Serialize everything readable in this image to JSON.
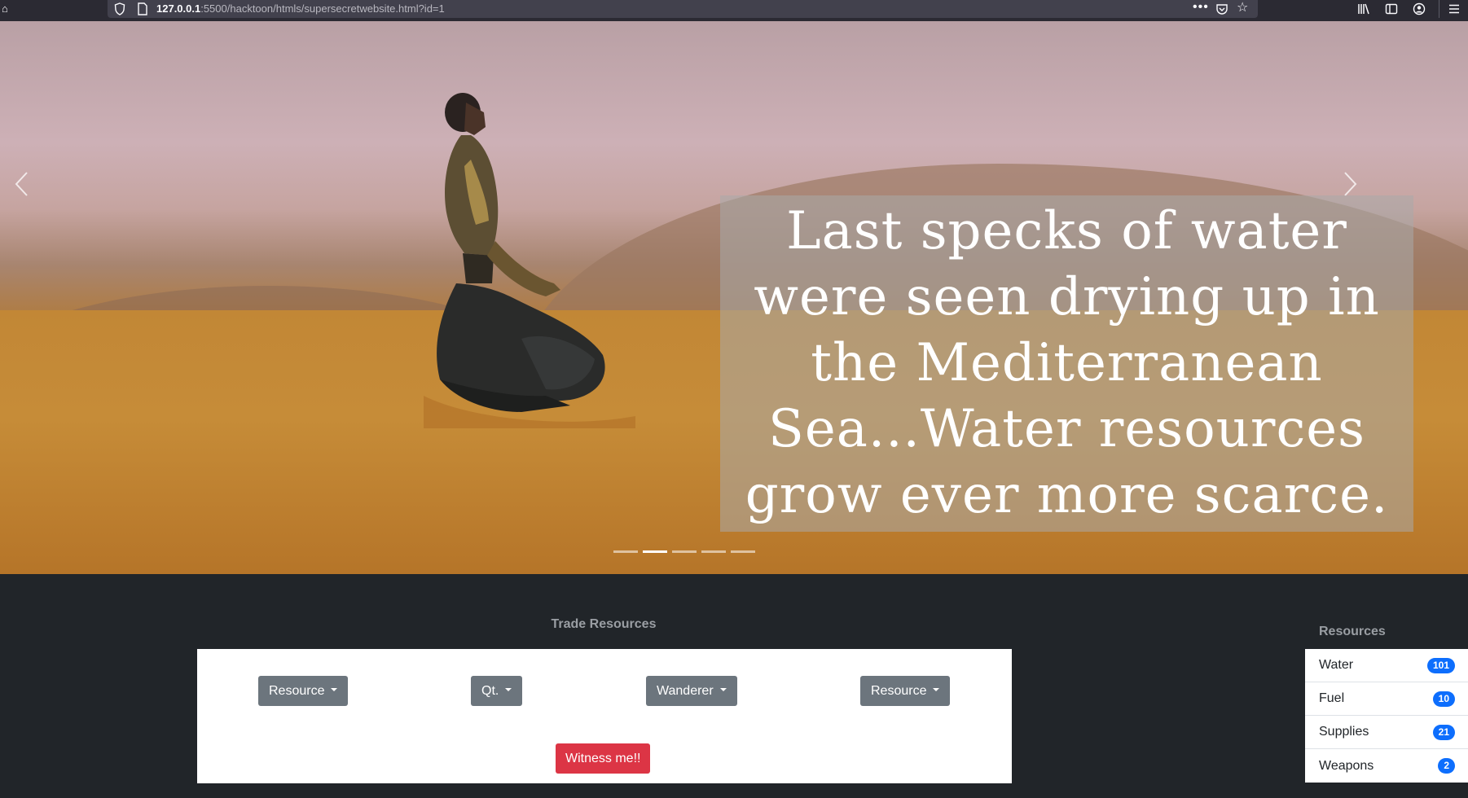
{
  "browser": {
    "url_host": "127.0.0.1",
    "url_rest": ":5500/hacktoon/htmls/supersecretwebsite.html?id=1",
    "page_actions_glyph": "•••"
  },
  "hero": {
    "caption": "Last specks of water were seen drying up in the Mediterranean Sea...Water resources grow ever more scarce.",
    "slide_count": 5,
    "active_slide": 2
  },
  "trade": {
    "title": "Trade Resources",
    "dropdowns": {
      "resource_from": "Resource",
      "quantity": "Qt.",
      "wanderer": "Wanderer",
      "resource_to": "Resource"
    },
    "submit_label": "Witness me!!"
  },
  "resources": {
    "title": "Resources",
    "items": [
      {
        "name": "Water",
        "count": "101"
      },
      {
        "name": "Fuel",
        "count": "10"
      },
      {
        "name": "Supplies",
        "count": "21"
      },
      {
        "name": "Weapons",
        "count": "2"
      }
    ]
  },
  "colors": {
    "page_bg": "#212529",
    "secondary_button": "#6c757d",
    "danger_button": "#dc3545",
    "badge": "#0d6efd"
  }
}
